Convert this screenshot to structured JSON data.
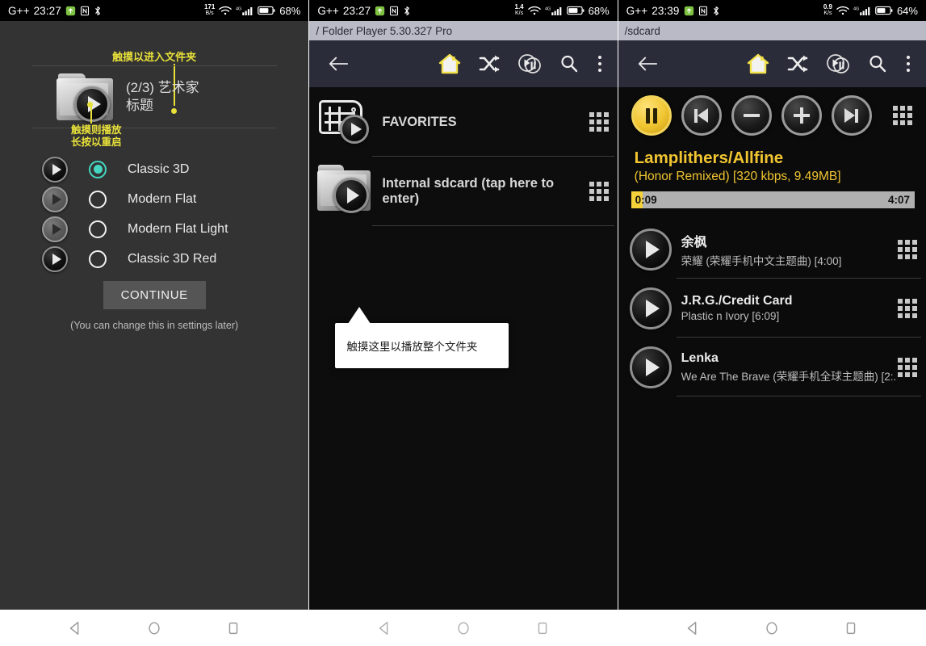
{
  "panels": [
    {
      "id": "theme-chooser",
      "statusbar": {
        "carrier": "G++",
        "time": "23:27",
        "icons": [
          "upload-icon",
          "nfc-icon",
          "bluetooth-icon"
        ],
        "net_rate_value": "171",
        "net_rate_unit": "B/s",
        "signal": "4G",
        "battery": "68%"
      },
      "hint_top": "触摸以进入文件夹",
      "folder_label_line1": "(2/3) 艺术家",
      "folder_label_line2": "标题",
      "hint_play_line1": "触摸则播放",
      "hint_play_line2": "长按以重启",
      "options": [
        {
          "label": "Classic 3D",
          "selected": true
        },
        {
          "label": "Modern Flat",
          "selected": false
        },
        {
          "label": "Modern Flat Light",
          "selected": false
        },
        {
          "label": "Classic 3D Red",
          "selected": false
        }
      ],
      "continue_label": "CONTINUE",
      "footnote": "(You can change this in settings later)",
      "accent_selected": "#45d6c0",
      "accent_hint": "#e8e13a"
    },
    {
      "id": "folder-browser",
      "statusbar": {
        "carrier": "G++",
        "time": "23:27",
        "net_rate_value": "1.4",
        "net_rate_unit": "K/s",
        "signal": "4G",
        "battery": "68%"
      },
      "path": "/ Folder Player 5.30.327  Pro",
      "toolbar": {
        "back": "back-arrow",
        "home": "home-icon",
        "shuffle": "shuffle-icon",
        "playpause": "play-pause-icon",
        "search": "search-icon",
        "overflow": "more-vert-icon"
      },
      "rows": [
        {
          "label": "FAVORITES",
          "icon": "favorites-tag-icon"
        },
        {
          "label": "Internal sdcard (tap here to enter)",
          "icon": "folder-icon"
        }
      ],
      "callout": "触摸这里以播放整个文件夹"
    },
    {
      "id": "now-playing",
      "statusbar": {
        "carrier": "G++",
        "time": "23:39",
        "net_rate_value": "0.9",
        "net_rate_unit": "K/s",
        "signal": "4G",
        "battery": "64%"
      },
      "path": "/sdcard",
      "toolbar": {
        "back": "back-arrow",
        "home": "home-icon",
        "shuffle": "shuffle-icon",
        "playpause": "play-pause-icon",
        "search": "search-icon",
        "overflow": "more-vert-icon"
      },
      "controls": [
        {
          "name": "pause-button",
          "active": true
        },
        {
          "name": "previous-button",
          "active": false
        },
        {
          "name": "volume-down-button",
          "active": false
        },
        {
          "name": "volume-up-button",
          "active": false
        },
        {
          "name": "next-button",
          "active": false
        }
      ],
      "now_playing": {
        "title": "Lamplithers/Allfine",
        "subtitle": "(Honor Remixed) [320 kbps, 9.49MB]",
        "elapsed": "0:09",
        "total": "4:07",
        "progress_percent": 4,
        "accent": "#f0c531",
        "bar_bg": "#b0b0b0"
      },
      "tracks": [
        {
          "title": "余枫",
          "subtitle": "荣耀 (荣耀手机中文主题曲) [4:00]"
        },
        {
          "title": "J.R.G./Credit Card",
          "subtitle": "Plastic n Ivory [6:09]"
        },
        {
          "title": "Lenka",
          "subtitle": "We Are The Brave (荣耀手机全球主题曲) [2:.."
        }
      ]
    }
  ],
  "navbar": {
    "back": "triangle-back-icon",
    "home": "circle-home-icon",
    "recents": "square-recents-icon"
  }
}
